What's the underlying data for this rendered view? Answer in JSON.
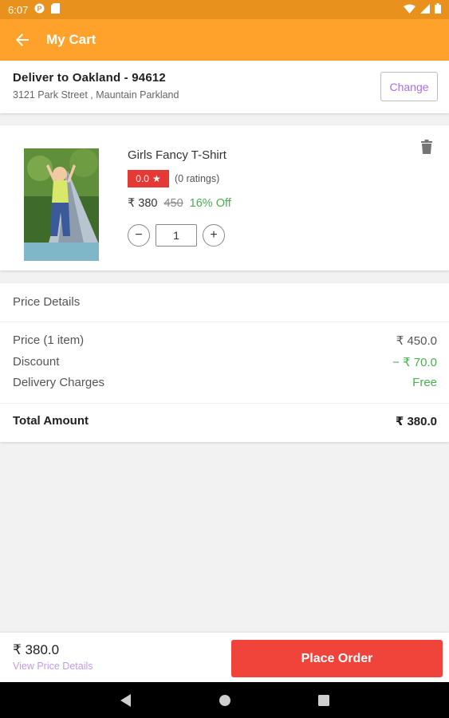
{
  "status_bar": {
    "time": "6:07",
    "icons": [
      "notification-p-icon",
      "sd-card-icon",
      "wifi-icon",
      "signal-icon",
      "battery-icon"
    ]
  },
  "app_bar": {
    "title": "My Cart",
    "back_icon": "arrow-back-icon",
    "background": "#ffa22b"
  },
  "address": {
    "line1": "Deliver to  Oakland  -  94612",
    "line2": "3121 Park Street ,  Mauntain Parkland",
    "change_label": "Change"
  },
  "cart_item": {
    "name": "Girls Fancy T-Shirt",
    "rating": "0.0",
    "rating_star": "★",
    "rating_count": "(0 ratings)",
    "price": "₹ 380",
    "original_price": "450",
    "discount": "16% Off",
    "quantity": "1",
    "minus": "−",
    "plus": "+",
    "delete_icon": "delete-icon"
  },
  "price_details": {
    "title": "Price Details",
    "rows": [
      {
        "label": "Price  (1 item)",
        "value": "₹ 450.0"
      },
      {
        "label": "Discount",
        "value": "− ₹ 70.0"
      },
      {
        "label": "Delivery Charges",
        "value": "Free"
      }
    ],
    "total_label": "Total Amount",
    "total_value": "₹ 380.0"
  },
  "bottom_bar": {
    "total": "₹ 380.0",
    "link": "View Price Details",
    "button": "Place Order"
  },
  "colors": {
    "accent": "#ffa22b",
    "green": "#4caf50",
    "red": "#f0433a",
    "purple": "#b06ee6"
  }
}
